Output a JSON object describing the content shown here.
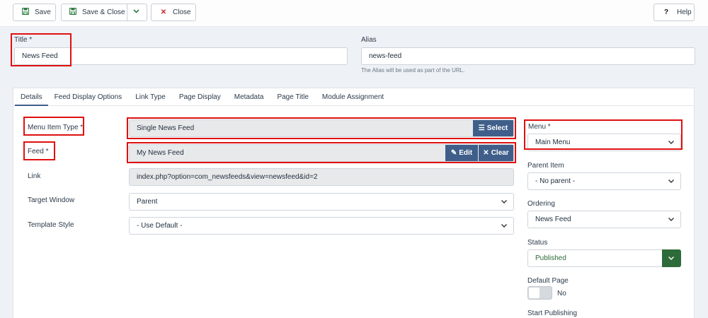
{
  "toolbar": {
    "save_label": "Save",
    "save_close_label": "Save & Close",
    "close_label": "Close",
    "help_label": "Help"
  },
  "header": {
    "title_label": "Title *",
    "title_value": "News Feed",
    "alias_label": "Alias",
    "alias_value": "news-feed",
    "alias_help": "The Alias will be used as part of the URL."
  },
  "tabs": [
    {
      "label": "Details",
      "active": true
    },
    {
      "label": "Feed Display Options"
    },
    {
      "label": "Link Type"
    },
    {
      "label": "Page Display"
    },
    {
      "label": "Metadata"
    },
    {
      "label": "Page Title"
    },
    {
      "label": "Module Assignment"
    }
  ],
  "details": {
    "menu_item_type_label": "Menu Item Type *",
    "menu_item_type_value": "Single News Feed",
    "select_button": "Select",
    "feed_label": "Feed *",
    "feed_value": "My News Feed",
    "edit_button": "Edit",
    "clear_button": "Clear",
    "link_label": "Link",
    "link_value": "index.php?option=com_newsfeeds&view=newsfeed&id=2",
    "target_window_label": "Target Window",
    "target_window_value": "Parent",
    "template_style_label": "Template Style",
    "template_style_value": "- Use Default -"
  },
  "sidebar": {
    "menu_label": "Menu *",
    "menu_value": "Main Menu",
    "parent_label": "Parent Item",
    "parent_value": "- No parent -",
    "ordering_label": "Ordering",
    "ordering_value": "News Feed",
    "status_label": "Status",
    "status_value": "Published",
    "default_page_label": "Default Page",
    "default_page_value": "No",
    "start_publishing_label": "Start Publishing"
  },
  "colors": {
    "accent_blue": "#3f5f8a",
    "published_green": "#2e6b3a",
    "highlight_red": "#e01010"
  }
}
